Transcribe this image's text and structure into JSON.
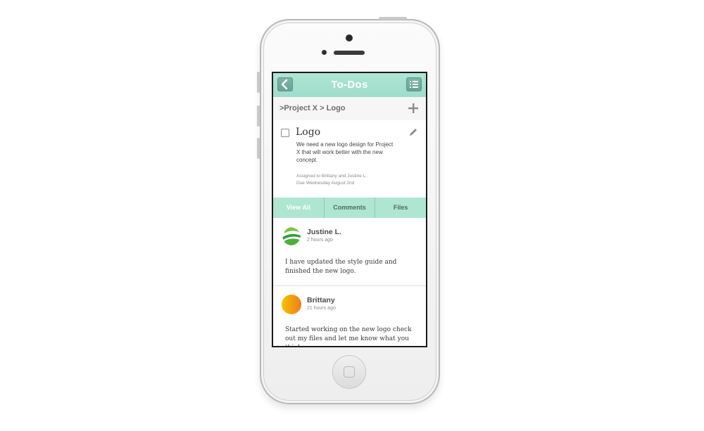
{
  "navbar": {
    "title": "To-Dos",
    "back_icon": "chevron-left-icon",
    "menu_icon": "list-icon"
  },
  "breadcrumb": {
    "path": ">Project X > Logo",
    "add_icon": "plus-icon"
  },
  "task": {
    "title": "Logo",
    "description": "We need a new logo design for Project X that will work better with the new concept.",
    "assigned": "Assigned to Brittany and Justine L.",
    "due": "Due Wednesday August 2nd",
    "edit_icon": "pencil-icon"
  },
  "tabs": [
    {
      "label": "View All",
      "active": true
    },
    {
      "label": "Comments",
      "active": false
    },
    {
      "label": "Files",
      "active": false
    }
  ],
  "comments": [
    {
      "author": "Justine L.",
      "time": "2 hours ago",
      "text": "I have updated the style guide and finished the new logo.",
      "avatar": "green-globe-avatar"
    },
    {
      "author": "Brittany",
      "time": "21 hours ago",
      "text": "Started working on the new logo check out my files and let me know what you think",
      "avatar": "orange-circle-avatar"
    }
  ],
  "colors": {
    "accent": "#aee6d2",
    "nav_button": "#6aa396"
  }
}
